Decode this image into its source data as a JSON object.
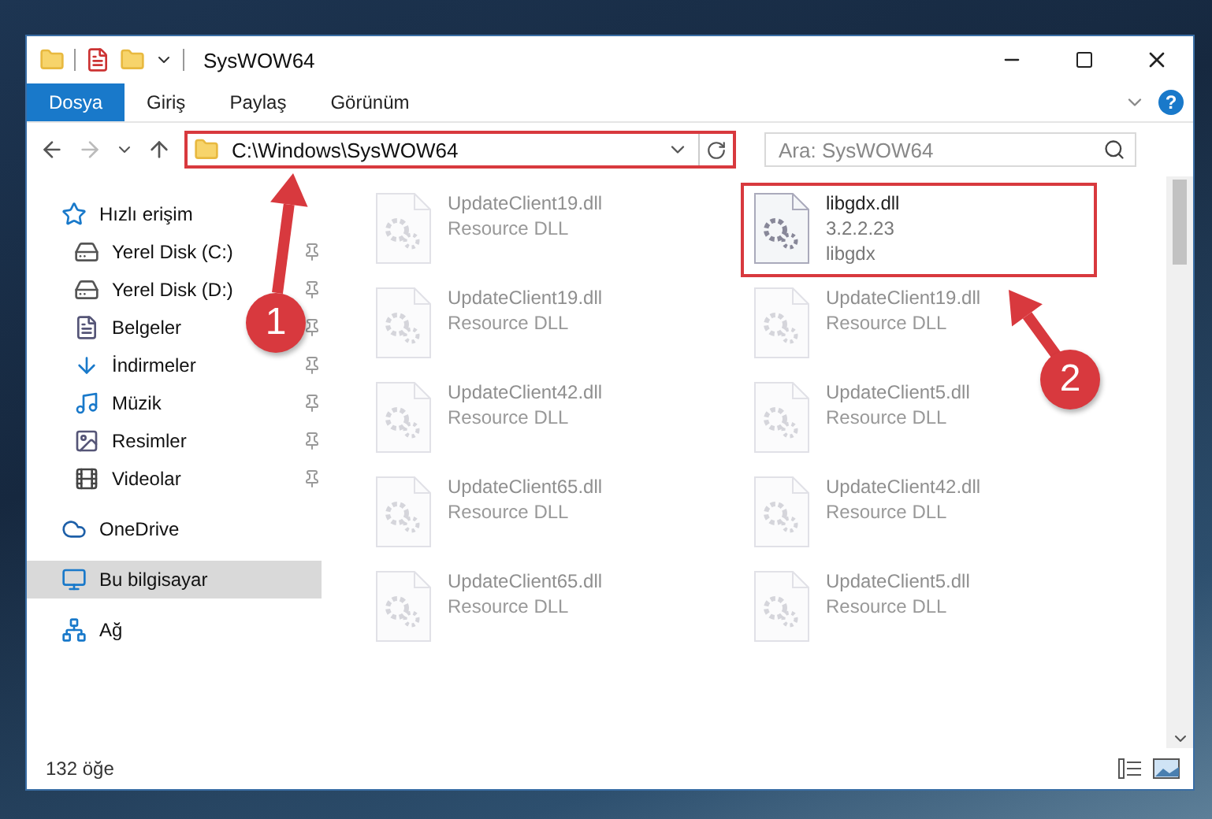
{
  "window": {
    "title": "SysWOW64"
  },
  "ribbon": {
    "tabs": [
      {
        "label": "Dosya",
        "selected": true
      },
      {
        "label": "Giriş",
        "selected": false
      },
      {
        "label": "Paylaş",
        "selected": false
      },
      {
        "label": "Görünüm",
        "selected": false
      }
    ],
    "help_label": "?"
  },
  "address_bar": {
    "path": "C:\\Windows\\SysWOW64",
    "highlighted": true
  },
  "search": {
    "placeholder": "Ara: SysWOW64"
  },
  "sidebar": {
    "items": [
      {
        "label": "Hızlı erişim",
        "selected": false,
        "children": [
          {
            "label": "Yerel Disk (C:)",
            "pinned": true,
            "selected": false
          },
          {
            "label": "Yerel Disk (D:)",
            "pinned": true,
            "selected": false
          },
          {
            "label": "Belgeler",
            "pinned": true,
            "selected": false
          },
          {
            "label": "İndirmeler",
            "pinned": true,
            "selected": false
          },
          {
            "label": "Müzik",
            "pinned": true,
            "selected": false
          },
          {
            "label": "Resimler",
            "pinned": true,
            "selected": false
          },
          {
            "label": "Videolar",
            "pinned": true,
            "selected": false
          }
        ]
      },
      {
        "label": "OneDrive",
        "selected": false
      },
      {
        "label": "Bu bilgisayar",
        "selected": true
      },
      {
        "label": "Ağ",
        "selected": false
      }
    ]
  },
  "files": [
    {
      "name": "UpdateClient19.dll",
      "lines": [
        "Resource DLL"
      ],
      "faded": true,
      "highlighted": false
    },
    {
      "name": "libgdx.dll",
      "lines": [
        "3.2.2.23",
        "libgdx"
      ],
      "faded": false,
      "highlighted": true
    },
    {
      "name": "UpdateClient19.dll",
      "lines": [
        "Resource DLL"
      ],
      "faded": true,
      "highlighted": false
    },
    {
      "name": "UpdateClient19.dll",
      "lines": [
        "Resource DLL"
      ],
      "faded": true,
      "highlighted": false
    },
    {
      "name": "UpdateClient42.dll",
      "lines": [
        "Resource DLL"
      ],
      "faded": true,
      "highlighted": false
    },
    {
      "name": "UpdateClient5.dll",
      "lines": [
        "Resource DLL"
      ],
      "faded": true,
      "highlighted": false
    },
    {
      "name": "UpdateClient65.dll",
      "lines": [
        "Resource DLL"
      ],
      "faded": true,
      "highlighted": false
    },
    {
      "name": "UpdateClient42.dll",
      "lines": [
        "Resource DLL"
      ],
      "faded": true,
      "highlighted": false
    },
    {
      "name": "UpdateClient65.dll",
      "lines": [
        "Resource DLL"
      ],
      "faded": true,
      "highlighted": false
    },
    {
      "name": "UpdateClient5.dll",
      "lines": [
        "Resource DLL"
      ],
      "faded": true,
      "highlighted": false
    }
  ],
  "status_bar": {
    "count": "132 öğe"
  },
  "annotations": [
    {
      "label": "1"
    },
    {
      "label": "2"
    }
  ]
}
